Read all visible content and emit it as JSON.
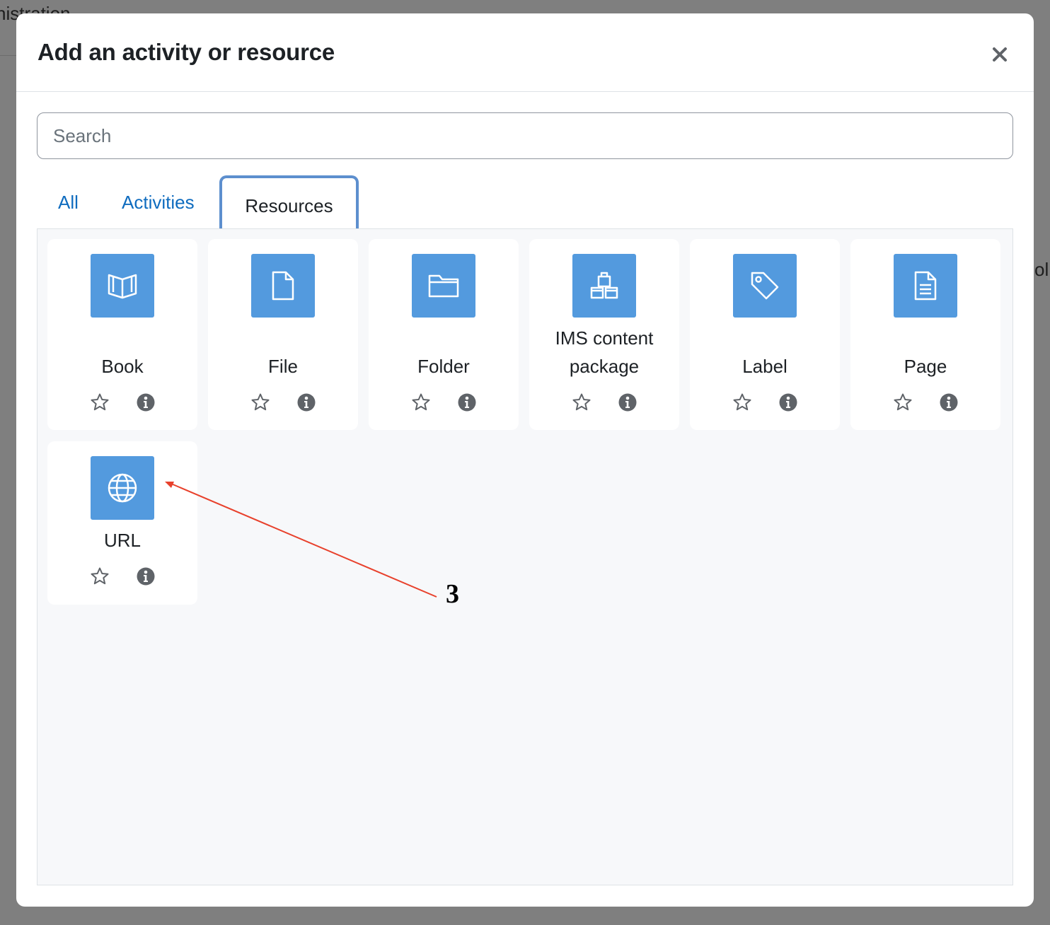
{
  "background": {
    "left_text": "nistration",
    "right_text": "ol"
  },
  "modal": {
    "title": "Add an activity or resource",
    "close_label": "×"
  },
  "search": {
    "placeholder": "Search",
    "value": ""
  },
  "tabs": [
    {
      "label": "All",
      "active": false
    },
    {
      "label": "Activities",
      "active": false
    },
    {
      "label": "Resources",
      "active": true
    }
  ],
  "items": [
    {
      "label_line1": "Book",
      "label_line2": "",
      "icon": "book-icon"
    },
    {
      "label_line1": "File",
      "label_line2": "",
      "icon": "file-icon"
    },
    {
      "label_line1": "Folder",
      "label_line2": "",
      "icon": "folder-icon"
    },
    {
      "label_line1": "IMS content",
      "label_line2": "package",
      "icon": "package-boxes-icon"
    },
    {
      "label_line1": "Label",
      "label_line2": "",
      "icon": "tag-icon"
    },
    {
      "label_line1": "Page",
      "label_line2": "",
      "icon": "page-document-icon"
    },
    {
      "label_line1": "URL",
      "label_line2": "",
      "icon": "globe-icon"
    }
  ],
  "annotation": {
    "number": "3",
    "color": "#e8412c"
  },
  "colors": {
    "icon_tile": "#539ade",
    "link": "#0f6cbf",
    "active_tab_border": "#5d8fce"
  }
}
